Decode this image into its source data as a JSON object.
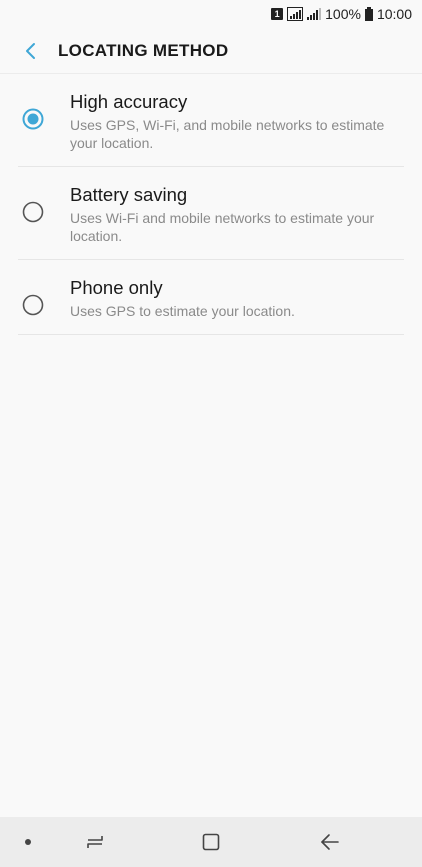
{
  "status_bar": {
    "sim_label": "1",
    "battery_percent": "100%",
    "time": "10:00"
  },
  "header": {
    "title": "LOCATING METHOD",
    "back_icon": "chevron-left-icon"
  },
  "options": [
    {
      "title": "High accuracy",
      "description": "Uses GPS, Wi-Fi, and mobile networks to estimate your location.",
      "selected": true
    },
    {
      "title": "Battery saving",
      "description": "Uses Wi-Fi and mobile networks to estimate your location.",
      "selected": false
    },
    {
      "title": "Phone only",
      "description": "Uses GPS to estimate your location.",
      "selected": false
    }
  ],
  "nav_bar": {
    "icons": [
      "dot-icon",
      "recent-apps-icon",
      "home-icon",
      "back-arrow-icon"
    ]
  },
  "colors": {
    "accent": "#3fa7d6",
    "radio_off": "#555555",
    "divider": "#e6e6e6",
    "nav_bg": "#ececec"
  }
}
